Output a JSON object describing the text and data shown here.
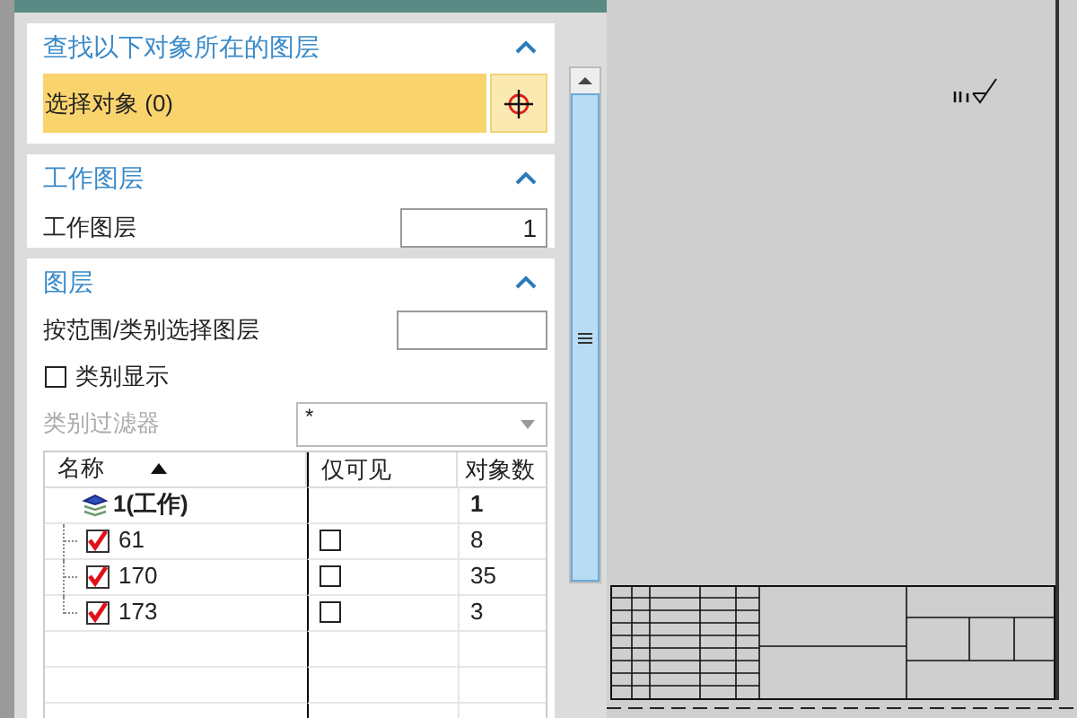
{
  "find_section": {
    "title": "查找以下对象所在的图层",
    "expanded": true,
    "select_label": "选择对象 (0)"
  },
  "work_section": {
    "title": "工作图层",
    "expanded": true,
    "label": "工作图层",
    "value": "1"
  },
  "layer_section": {
    "title": "图层",
    "expanded": true,
    "range_label": "按范围/类别选择图层",
    "category_display": {
      "label": "类别显示",
      "checked": false
    },
    "filter": {
      "label": "类别过滤器",
      "disabled": true,
      "value": "*"
    },
    "table": {
      "columns": [
        "名称",
        "仅可见",
        "对象数"
      ],
      "rows": [
        {
          "name": "1(工作)",
          "kind": "work",
          "count": "1"
        },
        {
          "name": "61",
          "kind": "layer",
          "checked": true,
          "visible_only": false,
          "count": "8"
        },
        {
          "name": "170",
          "kind": "layer",
          "checked": true,
          "visible_only": false,
          "count": "35"
        },
        {
          "name": "173",
          "kind": "layer",
          "checked": true,
          "visible_only": false,
          "count": "3"
        }
      ]
    }
  }
}
